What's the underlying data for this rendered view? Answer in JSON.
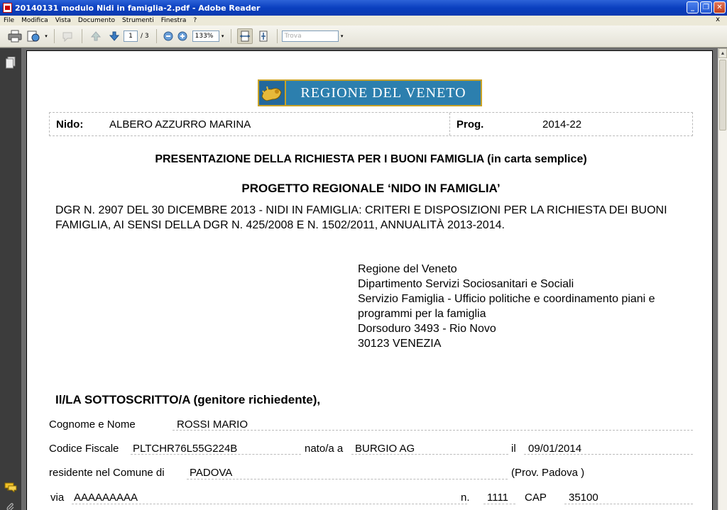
{
  "window": {
    "title": "20140131 modulo Nidi in famiglia-2.pdf - Adobe Reader",
    "buttons": [
      "_",
      "❐",
      "✕"
    ]
  },
  "menu": {
    "items": [
      "File",
      "Modifica",
      "Vista",
      "Documento",
      "Strumenti",
      "Finestra",
      "?"
    ],
    "close": "x"
  },
  "toolbar": {
    "page_current": "1",
    "page_separator": "/ 3",
    "zoom": "133%",
    "search_placeholder": "Trova"
  },
  "document": {
    "logo_text": "REGIONE DEL VENETO",
    "nido_label": "Nido:",
    "nido_value": "ALBERO AZZURRO MARINA",
    "prog_label": "Prog.",
    "prog_value": "2014-22",
    "title1": "PRESENTAZIONE DELLA RICHIESTA PER I BUONI FAMIGLIA (in carta semplice)",
    "title2": "PROGETTO REGIONALE ‘NIDO IN FAMIGLIA’",
    "dgr": "DGR N. 2907 DEL 30 DICEMBRE 2013 - NIDI IN FAMIGLIA: CRITERI E DISPOSIZIONI PER LA RICHIESTA DEI BUONI FAMIGLIA, AI SENSI DELLA DGR N. 425/2008 E N. 1502/2011, ANNUALITÀ 2013-2014.",
    "address": [
      "Regione del Veneto",
      "Dipartimento Servizi Sociosanitari e Sociali",
      "Servizio Famiglia - Ufficio politiche e coordinamento piani e",
      "programmi per la famiglia",
      "Dorsoduro 3493 - Rio Novo",
      "30123 VENEZIA"
    ],
    "sottoscritto": "Il/LA SOTTOSCRITTO/A (genitore richiedente),",
    "form": {
      "cognome_label": "Cognome e Nome",
      "cognome_value": "ROSSI MARIO",
      "cf_label": "Codice Fiscale",
      "cf_value": "PLTCHR76L55G224B",
      "nato_label": "nato/a a",
      "nato_value": "BURGIO AG",
      "il_label": "il",
      "il_value": "09/01/2014",
      "residente_label": "residente nel Comune di",
      "residente_value": "PADOVA",
      "prov": "(Prov. Padova )",
      "via_label": "via",
      "via_value": "AAAAAAAAA",
      "n_label": "n.",
      "n_value": "1111",
      "cap_label": "CAP",
      "cap_value": "35100"
    }
  }
}
